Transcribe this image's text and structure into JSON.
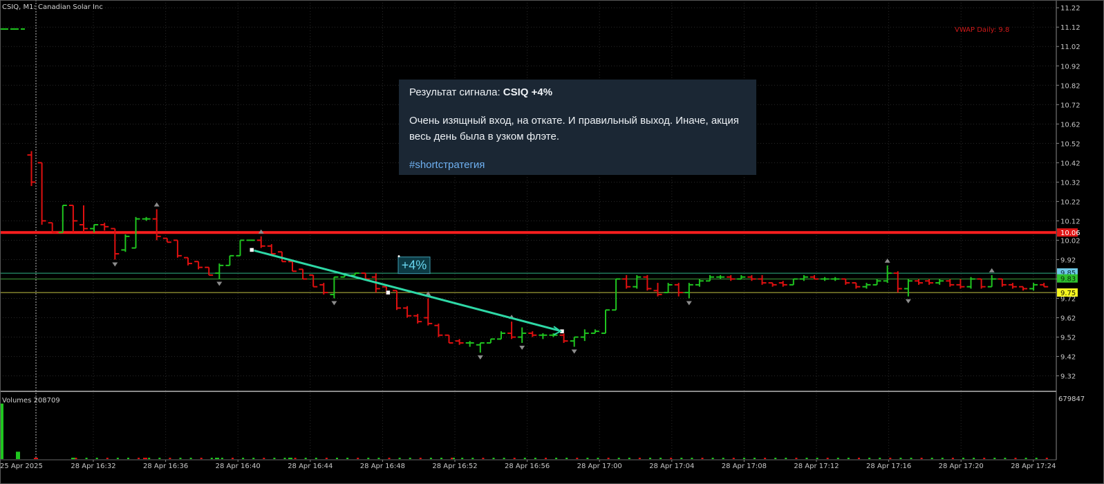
{
  "symbol_header": "CSIQ, M1:  Canadian Solar Inc",
  "vwap_label": "VWAP Daily: 9.8",
  "volumes_label": "Volumes 208709",
  "volume_axis_max": "679847",
  "colors": {
    "background": "#000000",
    "bull": "#1fc51f",
    "bear": "#e01010",
    "price_axis_text": "#c8c8c8",
    "grid": "#2b2b2b",
    "resistance_line": "#ff1e1e",
    "level_line_1": "#2fb588",
    "level_line_2": "#3f9e3a",
    "level_line_3": "#c2c244",
    "trade_line": "#2ed8a6",
    "label_red": "#e01616",
    "label_blue": "#6dc9e6",
    "label_green": "#2ec12e",
    "label_yellow": "#f5f520",
    "card_bg": "#1b2734",
    "hashtag": "#6fb1f2"
  },
  "message": {
    "intro": "Результат сигнала: ",
    "headline": "CSIQ +4%",
    "body": "Очень изящный вход, на откате. И правильный выход. Иначе, акция весь день была в узком флэте.",
    "hashtag": "#shortстратегия"
  },
  "chart_data": {
    "type": "bar",
    "title": "CSIQ, M1:  Canadian Solar Inc",
    "price_axis": {
      "ylim": [
        9.24,
        11.26
      ],
      "ticks": [
        "11.22",
        "11.12",
        "11.02",
        "10.92",
        "10.82",
        "10.72",
        "10.62",
        "10.52",
        "10.42",
        "10.32",
        "10.22",
        "10.12",
        "10.02",
        "9.92",
        "9.82",
        "9.72",
        "9.62",
        "9.52",
        "9.42",
        "9.32"
      ]
    },
    "time_axis": {
      "first_label": "25 Apr 2025",
      "labels": [
        "28 Apr 16:32",
        "28 Apr 16:36",
        "28 Apr 16:40",
        "28 Apr 16:44",
        "28 Apr 16:48",
        "28 Apr 16:52",
        "28 Apr 16:56",
        "28 Apr 17:00",
        "28 Apr 17:04",
        "28 Apr 17:08",
        "28 Apr 17:12",
        "28 Apr 17:16",
        "28 Apr 17:20",
        "28 Apr 17:24"
      ]
    },
    "price_labels": [
      {
        "text": "10.06",
        "price": 10.06,
        "color": "red"
      },
      {
        "text": "9.85",
        "price": 9.85,
        "color": "blue"
      },
      {
        "text": "9.83",
        "price": 9.83,
        "color": "green"
      },
      {
        "text": "9.75",
        "price": 9.75,
        "color": "yellow"
      }
    ],
    "levels": [
      {
        "name": "resistance",
        "price": 10.06
      },
      {
        "name": "level-1",
        "price": 9.85
      },
      {
        "name": "level-2",
        "price": 9.82
      },
      {
        "name": "level-3",
        "price": 9.75
      }
    ],
    "trade": {
      "label": "+4%",
      "entry": {
        "time": "28 Apr 16:40",
        "price": 9.97
      },
      "mid": {
        "time": "28 Apr 16:48",
        "price": 9.75
      },
      "exit": {
        "time": "28 Apr 16:57",
        "price": 9.55
      }
    },
    "series": [
      {
        "name": "Volumes",
        "values": [
          600000,
          80000,
          12000,
          5000,
          3000,
          2000,
          3000,
          2000
        ]
      }
    ],
    "bars": [
      {
        "o": 10.46,
        "h": 10.48,
        "l": 10.3,
        "c": 10.32
      },
      {
        "o": 10.42,
        "h": 10.42,
        "l": 10.1,
        "c": 10.12
      },
      {
        "o": 10.11,
        "h": 10.11,
        "l": 10.06,
        "c": 10.06
      },
      {
        "o": 10.06,
        "h": 10.2,
        "l": 10.06,
        "c": 10.2
      },
      {
        "o": 10.2,
        "h": 10.2,
        "l": 10.06,
        "c": 10.12
      },
      {
        "o": 10.1,
        "h": 10.2,
        "l": 10.06,
        "c": 10.08
      },
      {
        "o": 10.08,
        "h": 10.1,
        "l": 10.06,
        "c": 10.1
      },
      {
        "o": 10.1,
        "h": 10.11,
        "l": 10.07,
        "c": 10.09
      },
      {
        "o": 10.08,
        "h": 10.08,
        "l": 9.92,
        "c": 9.95
      },
      {
        "o": 9.97,
        "h": 10.05,
        "l": 9.96,
        "c": 10.04
      },
      {
        "o": 9.98,
        "h": 10.14,
        "l": 9.98,
        "c": 10.13
      },
      {
        "o": 10.13,
        "h": 10.14,
        "l": 10.12,
        "c": 10.13
      },
      {
        "o": 10.13,
        "h": 10.18,
        "l": 10.02,
        "c": 10.04
      },
      {
        "o": 10.03,
        "h": 10.03,
        "l": 10.01,
        "c": 10.01
      },
      {
        "o": 10.02,
        "h": 10.02,
        "l": 9.93,
        "c": 9.94
      },
      {
        "o": 9.93,
        "h": 9.93,
        "l": 9.89,
        "c": 9.9
      },
      {
        "o": 9.91,
        "h": 9.91,
        "l": 9.87,
        "c": 9.88
      },
      {
        "o": 9.88,
        "h": 9.88,
        "l": 9.84,
        "c": 9.84
      },
      {
        "o": 9.85,
        "h": 9.9,
        "l": 9.82,
        "c": 9.89
      },
      {
        "o": 9.89,
        "h": 9.94,
        "l": 9.89,
        "c": 9.94
      },
      {
        "o": 9.94,
        "h": 10.02,
        "l": 9.94,
        "c": 10.02
      },
      {
        "o": 10.02,
        "h": 10.02,
        "l": 10.02,
        "c": 10.02
      },
      {
        "o": 10.02,
        "h": 10.04,
        "l": 9.98,
        "c": 9.99
      },
      {
        "o": 9.99,
        "h": 10.0,
        "l": 9.94,
        "c": 9.95
      },
      {
        "o": 9.96,
        "h": 9.96,
        "l": 9.91,
        "c": 9.91
      },
      {
        "o": 9.91,
        "h": 9.91,
        "l": 9.86,
        "c": 9.86
      },
      {
        "o": 9.87,
        "h": 9.87,
        "l": 9.82,
        "c": 9.82
      },
      {
        "o": 9.84,
        "h": 9.84,
        "l": 9.78,
        "c": 9.78
      },
      {
        "o": 9.79,
        "h": 9.8,
        "l": 9.74,
        "c": 9.75
      },
      {
        "o": 9.74,
        "h": 9.83,
        "l": 9.72,
        "c": 9.83
      },
      {
        "o": 9.83,
        "h": 9.84,
        "l": 9.83,
        "c": 9.84
      },
      {
        "o": 9.84,
        "h": 9.85,
        "l": 9.84,
        "c": 9.85
      },
      {
        "o": 9.85,
        "h": 9.85,
        "l": 9.82,
        "c": 9.82
      },
      {
        "o": 9.83,
        "h": 9.85,
        "l": 9.75,
        "c": 9.77
      },
      {
        "o": 9.78,
        "h": 9.78,
        "l": 9.74,
        "c": 9.75
      },
      {
        "o": 9.76,
        "h": 9.76,
        "l": 9.66,
        "c": 9.67
      },
      {
        "o": 9.67,
        "h": 9.68,
        "l": 9.62,
        "c": 9.63
      },
      {
        "o": 9.63,
        "h": 9.64,
        "l": 9.59,
        "c": 9.6
      },
      {
        "o": 9.62,
        "h": 9.72,
        "l": 9.58,
        "c": 9.59
      },
      {
        "o": 9.58,
        "h": 9.59,
        "l": 9.52,
        "c": 9.53
      },
      {
        "o": 9.53,
        "h": 9.53,
        "l": 9.49,
        "c": 9.49
      },
      {
        "o": 9.5,
        "h": 9.51,
        "l": 9.48,
        "c": 9.49
      },
      {
        "o": 9.49,
        "h": 9.5,
        "l": 9.47,
        "c": 9.49
      },
      {
        "o": 9.48,
        "h": 9.49,
        "l": 9.44,
        "c": 9.49
      },
      {
        "o": 9.49,
        "h": 9.51,
        "l": 9.49,
        "c": 9.51
      },
      {
        "o": 9.51,
        "h": 9.55,
        "l": 9.51,
        "c": 9.54
      },
      {
        "o": 9.54,
        "h": 9.6,
        "l": 9.51,
        "c": 9.52
      },
      {
        "o": 9.52,
        "h": 9.57,
        "l": 9.49,
        "c": 9.54
      },
      {
        "o": 9.54,
        "h": 9.55,
        "l": 9.52,
        "c": 9.53
      },
      {
        "o": 9.53,
        "h": 9.54,
        "l": 9.51,
        "c": 9.53
      },
      {
        "o": 9.53,
        "h": 9.54,
        "l": 9.52,
        "c": 9.53
      },
      {
        "o": 9.53,
        "h": 9.54,
        "l": 9.49,
        "c": 9.5
      },
      {
        "o": 9.5,
        "h": 9.52,
        "l": 9.47,
        "c": 9.52
      },
      {
        "o": 9.52,
        "h": 9.56,
        "l": 9.5,
        "c": 9.54
      },
      {
        "o": 9.54,
        "h": 9.56,
        "l": 9.54,
        "c": 9.55
      },
      {
        "o": 9.54,
        "h": 9.66,
        "l": 9.54,
        "c": 9.66
      },
      {
        "o": 9.66,
        "h": 9.82,
        "l": 9.66,
        "c": 9.82
      },
      {
        "o": 9.82,
        "h": 9.84,
        "l": 9.77,
        "c": 9.78
      },
      {
        "o": 9.78,
        "h": 9.84,
        "l": 9.77,
        "c": 9.83
      },
      {
        "o": 9.83,
        "h": 9.84,
        "l": 9.76,
        "c": 9.77
      },
      {
        "o": 9.76,
        "h": 9.8,
        "l": 9.73,
        "c": 9.74
      },
      {
        "o": 9.75,
        "h": 9.8,
        "l": 9.75,
        "c": 9.79
      },
      {
        "o": 9.79,
        "h": 9.8,
        "l": 9.73,
        "c": 9.75
      },
      {
        "o": 9.75,
        "h": 9.8,
        "l": 9.72,
        "c": 9.79
      },
      {
        "o": 9.79,
        "h": 9.82,
        "l": 9.78,
        "c": 9.81
      },
      {
        "o": 9.81,
        "h": 9.84,
        "l": 9.81,
        "c": 9.83
      },
      {
        "o": 9.83,
        "h": 9.84,
        "l": 9.82,
        "c": 9.83
      },
      {
        "o": 9.83,
        "h": 9.84,
        "l": 9.81,
        "c": 9.82
      },
      {
        "o": 9.82,
        "h": 9.84,
        "l": 9.82,
        "c": 9.83
      },
      {
        "o": 9.83,
        "h": 9.84,
        "l": 9.81,
        "c": 9.82
      },
      {
        "o": 9.82,
        "h": 9.84,
        "l": 9.79,
        "c": 9.8
      },
      {
        "o": 9.8,
        "h": 9.8,
        "l": 9.78,
        "c": 9.79
      },
      {
        "o": 9.8,
        "h": 9.81,
        "l": 9.78,
        "c": 9.79
      },
      {
        "o": 9.79,
        "h": 9.82,
        "l": 9.79,
        "c": 9.82
      },
      {
        "o": 9.82,
        "h": 9.84,
        "l": 9.81,
        "c": 9.83
      },
      {
        "o": 9.83,
        "h": 9.84,
        "l": 9.82,
        "c": 9.82
      },
      {
        "o": 9.82,
        "h": 9.83,
        "l": 9.81,
        "c": 9.82
      },
      {
        "o": 9.82,
        "h": 9.83,
        "l": 9.81,
        "c": 9.82
      },
      {
        "o": 9.82,
        "h": 9.82,
        "l": 9.79,
        "c": 9.8
      },
      {
        "o": 9.8,
        "h": 9.8,
        "l": 9.77,
        "c": 9.78
      },
      {
        "o": 9.78,
        "h": 9.8,
        "l": 9.77,
        "c": 9.79
      },
      {
        "o": 9.79,
        "h": 9.82,
        "l": 9.79,
        "c": 9.81
      },
      {
        "o": 9.81,
        "h": 9.89,
        "l": 9.8,
        "c": 9.85
      },
      {
        "o": 9.85,
        "h": 9.86,
        "l": 9.75,
        "c": 9.77
      },
      {
        "o": 9.77,
        "h": 9.82,
        "l": 9.73,
        "c": 9.81
      },
      {
        "o": 9.81,
        "h": 9.82,
        "l": 9.79,
        "c": 9.8
      },
      {
        "o": 9.81,
        "h": 9.82,
        "l": 9.79,
        "c": 9.8
      },
      {
        "o": 9.8,
        "h": 9.82,
        "l": 9.79,
        "c": 9.81
      },
      {
        "o": 9.81,
        "h": 9.82,
        "l": 9.78,
        "c": 9.79
      },
      {
        "o": 9.79,
        "h": 9.82,
        "l": 9.77,
        "c": 9.78
      },
      {
        "o": 9.78,
        "h": 9.83,
        "l": 9.77,
        "c": 9.82
      },
      {
        "o": 9.82,
        "h": 9.82,
        "l": 9.77,
        "c": 9.78
      },
      {
        "o": 9.78,
        "h": 9.84,
        "l": 9.78,
        "c": 9.82
      },
      {
        "o": 9.82,
        "h": 9.82,
        "l": 9.78,
        "c": 9.79
      },
      {
        "o": 9.79,
        "h": 9.8,
        "l": 9.77,
        "c": 9.78
      },
      {
        "o": 9.78,
        "h": 9.78,
        "l": 9.76,
        "c": 9.77
      },
      {
        "o": 9.77,
        "h": 9.8,
        "l": 9.76,
        "c": 9.79
      },
      {
        "o": 9.79,
        "h": 9.8,
        "l": 9.78,
        "c": 9.78
      },
      {
        "o": 9.79,
        "h": 9.8,
        "l": 9.77,
        "c": 9.78
      },
      {
        "o": 9.78,
        "h": 9.79,
        "l": 9.75,
        "c": 9.76
      },
      {
        "o": 9.76,
        "h": 9.78,
        "l": 9.71,
        "c": 9.73
      },
      {
        "o": 9.75,
        "h": 9.82,
        "l": 9.75,
        "c": 9.81
      }
    ]
  }
}
